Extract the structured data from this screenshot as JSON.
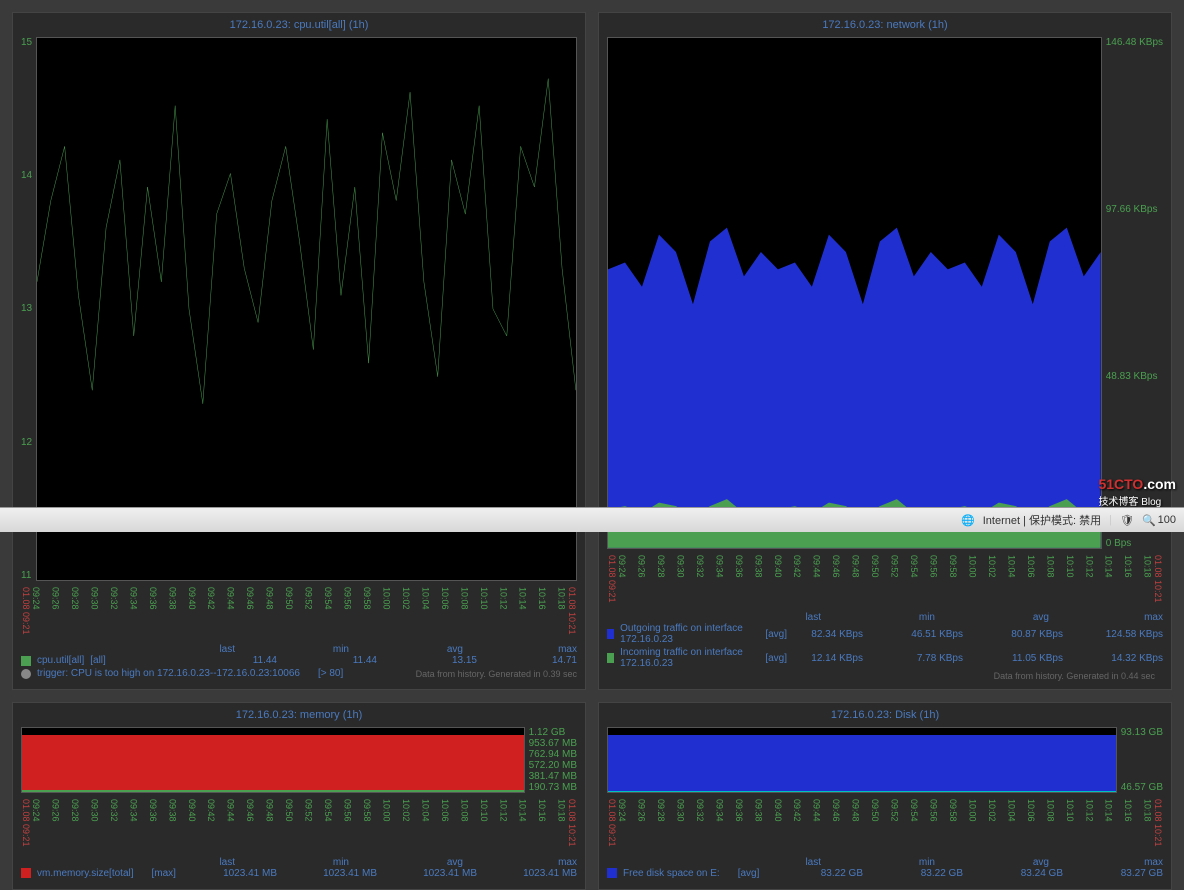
{
  "charts": [
    {
      "title": "172.16.0.23: cpu.util[all]  (1h)",
      "yaxis_left": [
        "15",
        "14",
        "13",
        "12",
        "11"
      ],
      "xaxis_start": "01.08 09:21",
      "xaxis_end": "01.08 10:21",
      "xticks": [
        "09:24",
        "09:26",
        "09:28",
        "09:30",
        "09:32",
        "09:34",
        "09:36",
        "09:38",
        "09:40",
        "09:42",
        "09:44",
        "09:46",
        "09:48",
        "09:50",
        "09:52",
        "09:54",
        "09:56",
        "09:58",
        "10:00",
        "10:02",
        "10:04",
        "10:06",
        "10:08",
        "10:10",
        "10:12",
        "10:14",
        "10:16",
        "10:18"
      ],
      "legend": [
        {
          "box": "#4aa050",
          "label": "cpu.util[all]",
          "mode": "[all]",
          "stats": {
            "last": "11.44",
            "min": "11.44",
            "avg": "13.15",
            "max": "14.71"
          }
        }
      ],
      "trigger": {
        "dot": "#888",
        "text": "trigger: CPU is too high on 172.16.0.23--172.16.0.23:10066",
        "val": "[> 80]"
      },
      "footer": "Data from history. Generated in 0.39 sec",
      "chart_data": {
        "type": "line",
        "ylim": [
          11,
          15
        ],
        "values": [
          13.2,
          13.8,
          14.2,
          13.1,
          12.4,
          13.6,
          14.1,
          12.8,
          13.9,
          13.2,
          14.5,
          13.0,
          12.3,
          13.7,
          14.0,
          13.3,
          12.9,
          13.8,
          14.2,
          13.5,
          12.7,
          14.4,
          13.1,
          13.9,
          12.6,
          14.3,
          13.8,
          14.6,
          13.2,
          12.5,
          14.1,
          13.7,
          14.5,
          13.0,
          12.8,
          14.2,
          13.9,
          14.7,
          13.3,
          12.4
        ]
      }
    },
    {
      "title": "172.16.0.23: network  (1h)",
      "yaxis_right": [
        "146.48 KBps",
        "97.66 KBps",
        "48.83 KBps",
        "0 Bps"
      ],
      "xaxis_start": "01.08 09:21",
      "xaxis_end": "01.08 10:21",
      "xticks": [
        "09:24",
        "09:26",
        "09:28",
        "09:30",
        "09:32",
        "09:34",
        "09:36",
        "09:38",
        "09:40",
        "09:42",
        "09:44",
        "09:46",
        "09:48",
        "09:50",
        "09:52",
        "09:54",
        "09:56",
        "09:58",
        "10:00",
        "10:02",
        "10:04",
        "10:06",
        "10:08",
        "10:10",
        "10:12",
        "10:14",
        "10:16",
        "10:18"
      ],
      "legend": [
        {
          "box": "#2030d0",
          "label": "Outgoing traffic on interface 172.16.0.23",
          "mode": "[avg]",
          "stats": {
            "last": "82.34 KBps",
            "min": "46.51 KBps",
            "avg": "80.87 KBps",
            "max": "124.58 KBps"
          }
        },
        {
          "box": "#4aa050",
          "label": "Incoming traffic on interface 172.16.0.23",
          "mode": "[avg]",
          "stats": {
            "last": "12.14 KBps",
            "min": "7.78 KBps",
            "avg": "11.05 KBps",
            "max": "14.32 KBps"
          }
        }
      ],
      "footer": "Data from history. Generated in 0.44 sec",
      "chart_data": {
        "type": "area",
        "ylim": [
          0,
          146.48
        ],
        "series": [
          {
            "name": "out",
            "values": [
              80,
              82,
              75,
              90,
              85,
              70,
              88,
              92,
              78,
              85,
              80,
              82,
              75,
              90,
              85,
              70,
              88,
              92,
              78,
              85,
              80,
              82,
              75,
              90,
              85,
              70,
              88,
              92,
              78,
              85
            ]
          },
          {
            "name": "in",
            "values": [
              11,
              12,
              10,
              13,
              12,
              9,
              12,
              14,
              10,
              11,
              11,
              12,
              10,
              13,
              12,
              9,
              12,
              14,
              10,
              11,
              11,
              12,
              10,
              13,
              12,
              9,
              12,
              14,
              10,
              11
            ]
          }
        ]
      }
    },
    {
      "title": "172.16.0.23: memory  (1h)",
      "yaxis_right": [
        "1.12 GB",
        "953.67 MB",
        "762.94 MB",
        "572.20 MB",
        "381.47 MB",
        "190.73 MB"
      ],
      "xaxis_start": "01.08 09:21",
      "xaxis_end": "01.08 10:21",
      "xticks": [
        "09:24",
        "09:26",
        "09:28",
        "09:30",
        "09:32",
        "09:34",
        "09:36",
        "09:38",
        "09:40",
        "09:42",
        "09:44",
        "09:46",
        "09:48",
        "09:50",
        "09:52",
        "09:54",
        "09:56",
        "09:58",
        "10:00",
        "10:02",
        "10:04",
        "10:06",
        "10:08",
        "10:10",
        "10:12",
        "10:14",
        "10:16",
        "10:18"
      ],
      "legend": [
        {
          "box": "#d02020",
          "label": "vm.memory.size[total]",
          "mode": "[max]",
          "stats": {
            "last": "1023.41 MB",
            "min": "1023.41 MB",
            "avg": "1023.41 MB",
            "max": "1023.41 MB"
          }
        }
      ],
      "chart_data": {
        "type": "area",
        "ylim": [
          0,
          1146
        ],
        "values_constant": 1023.41
      }
    },
    {
      "title": "172.16.0.23: Disk  (1h)",
      "yaxis_right": [
        "93.13 GB",
        "46.57 GB"
      ],
      "xaxis_start": "01.08 09:21",
      "xaxis_end": "01.08 10:21",
      "xticks": [
        "09:24",
        "09:26",
        "09:28",
        "09:30",
        "09:32",
        "09:34",
        "09:36",
        "09:38",
        "09:40",
        "09:42",
        "09:44",
        "09:46",
        "09:48",
        "09:50",
        "09:52",
        "09:54",
        "09:56",
        "09:58",
        "10:00",
        "10:02",
        "10:04",
        "10:06",
        "10:08",
        "10:10",
        "10:12",
        "10:14",
        "10:16",
        "10:18"
      ],
      "legend": [
        {
          "box": "#2030d0",
          "label": "Free disk space on E:",
          "mode": "[avg]",
          "stats": {
            "last": "83.22 GB",
            "min": "83.22 GB",
            "avg": "83.24 GB",
            "max": "83.27 GB"
          }
        }
      ],
      "chart_data": {
        "type": "area",
        "ylim": [
          0,
          93.13
        ],
        "values_constant": 83.22
      }
    }
  ],
  "statusbar": {
    "security": "Internet | 保护模式: 禁用",
    "zoom": "100"
  },
  "logo": {
    "main": "51CTO",
    "suffix": ".com",
    "sub": "技术博客 Blog"
  }
}
